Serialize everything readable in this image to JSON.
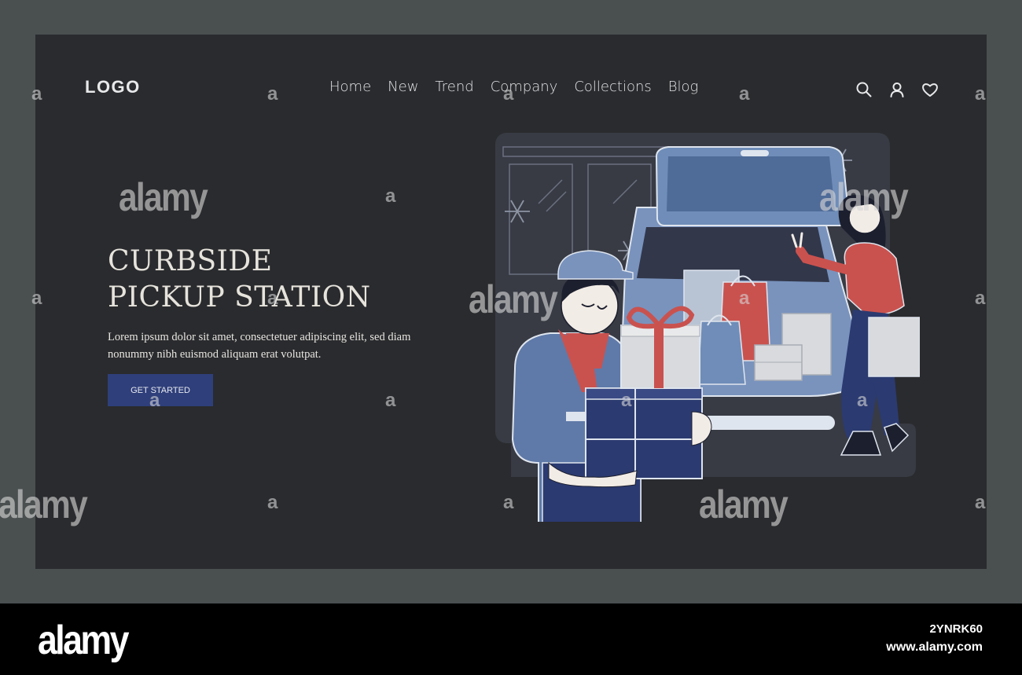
{
  "header": {
    "logo": "LOGO",
    "nav": [
      "Home",
      "New",
      "Trend",
      "Company",
      "Collections",
      "Blog"
    ],
    "icons": [
      "search-icon",
      "user-icon",
      "heart-icon"
    ]
  },
  "hero": {
    "title_line1": "CURBSIDE",
    "title_line2": "PICKUP STATION",
    "description": "Lorem ipsum dolor sit amet, consectetuer adipiscing elit, sed diam nonummy nibh euismod aliquam erat volutpat.",
    "cta_label": "GET STARTED"
  },
  "watermark": {
    "text": "alamy",
    "small": "a",
    "image_id": "2YNRK60",
    "url": "www.alamy.com"
  },
  "colors": {
    "background": "#2a2b2e",
    "frame_border": "#4a4f50",
    "accent": "#2f3f7b",
    "red_accent": "#c9524f",
    "blue_light": "#6f8db8"
  }
}
